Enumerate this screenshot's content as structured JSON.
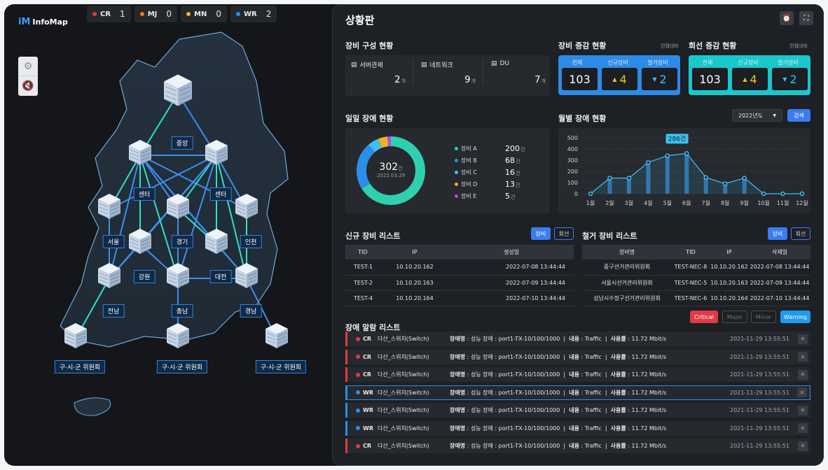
{
  "app": {
    "logo_text": "InfoMap",
    "logo_mark": "iM"
  },
  "counters": [
    {
      "code": "CR",
      "value": "1",
      "color": "#e03a45"
    },
    {
      "code": "MJ",
      "value": "0",
      "color": "#f07a1f"
    },
    {
      "code": "MN",
      "value": "0",
      "color": "#f0b21f"
    },
    {
      "code": "WR",
      "value": "2",
      "color": "#2b8fe6"
    }
  ],
  "side_buttons": {
    "settings_icon": "⚙",
    "mute_icon": "🔇"
  },
  "map": {
    "nodes": [
      "중앙",
      "센터",
      "센터",
      "서울",
      "경기",
      "인천",
      "강원",
      "대전",
      "전남",
      "충남",
      "경남",
      "구·시·군 위원회",
      "구·시·군 위원회",
      "구·시·군 위원회"
    ]
  },
  "panel": {
    "title": "상황판",
    "alarm_icon": "⏰",
    "fullscreen_icon": "⛶",
    "config": {
      "title": "장비 구성 현황",
      "unit": "개",
      "items": [
        {
          "name": "서버관제",
          "count": "2"
        },
        {
          "name": "네트워크",
          "count": "9"
        },
        {
          "name": "DU",
          "count": "7"
        }
      ]
    },
    "equip_change": {
      "title": "장비 증감 현황",
      "sub": "전월대비",
      "headers": [
        "전체",
        "신규장비",
        "철거장비"
      ],
      "total": "103",
      "new": "4",
      "removed": "2"
    },
    "line_change": {
      "title": "회선 증감 현황",
      "sub": "전월대비",
      "headers": [
        "전체",
        "신규장비",
        "철거장비"
      ],
      "total": "103",
      "new": "4",
      "removed": "2"
    },
    "daily": {
      "title": "일일 장애 현황",
      "center_value": "302",
      "center_unit": "건",
      "center_date": "2022.03.29",
      "unit": "건",
      "items": [
        {
          "name": "장비 A",
          "value": 200,
          "color": "#2fd0b0"
        },
        {
          "name": "장비 B",
          "value": 68,
          "color": "#2b8fe6"
        },
        {
          "name": "장비 C",
          "value": 16,
          "color": "#3ec1f0"
        },
        {
          "name": "장비 D",
          "value": 13,
          "color": "#f0b21f"
        },
        {
          "name": "장비 E",
          "value": 5,
          "color": "#b04fe0"
        }
      ]
    },
    "monthly": {
      "title": "월별 장애 현황",
      "year_select": "2022년도",
      "search_label": "검색",
      "highlight_label": "286건"
    },
    "new_list": {
      "title": "신규 장비 리스트",
      "tab_equip": "장비",
      "tab_line": "회선",
      "headers": [
        "TID",
        "IP",
        "생성일"
      ],
      "rows": [
        [
          "TEST-1",
          "10.10.20.162",
          "2022-07-08 13:44:44"
        ],
        [
          "TEST-2",
          "10.10.20.163",
          "2022-07-09 13:44:44"
        ],
        [
          "TEST-4",
          "10.10.20.164",
          "2022-07-10 13:44:44"
        ]
      ]
    },
    "removed_list": {
      "title": "철거 장비 리스트",
      "tab_equip": "장비",
      "tab_line": "회선",
      "headers": [
        "장비명",
        "TID",
        "IP",
        "삭제일"
      ],
      "rows": [
        [
          "중구선거관리위원회",
          "TEST-NEC-8",
          "10.10.20.162",
          "2022-07-08 13:44:44"
        ],
        [
          "서울시선거관리위원회",
          "TEST-NEC-5",
          "10.10.20.163",
          "2022-07-09 13:44:44"
        ],
        [
          "성남시수정구선거관리위원회",
          "TEST-NEC-6",
          "10.10.20.164",
          "2022-07-10 13:44:44"
        ]
      ]
    },
    "alarms": {
      "title": "장애 알람 리스트",
      "filters": [
        "Critical",
        "Major",
        "Minor",
        "Warning"
      ],
      "close_icon": "✕",
      "rows": [
        {
          "level": "CR",
          "device": "다산_스위치(Switch)",
          "k1": "장애명",
          "v1": " : 성능 장애 : port1-TX-10/100/1000",
          "k2": "내용",
          "v2": " : Traffic",
          "k3": "사용률",
          "v3": " : 11.72 Mbit/s",
          "time": "2021-11-29  13:55:51"
        },
        {
          "level": "CR",
          "device": "다산_스위치(Switch)",
          "k1": "장애명",
          "v1": " : 성능 장애 : port1-TX-10/100/1000",
          "k2": "내용",
          "v2": " : Traffic",
          "k3": "사용률",
          "v3": " : 11.72 Mbit/s",
          "time": "2021-11-29  13:55:51"
        },
        {
          "level": "CR",
          "device": "다산_스위치(Switch)",
          "k1": "장애명",
          "v1": " : 성능 장애 : port1-TX-10/100/1000",
          "k2": "내용",
          "v2": " : Traffic",
          "k3": "사용률",
          "v3": " : 11.72 Mbit/s",
          "time": "2021-11-29  13:55:51"
        },
        {
          "level": "WR",
          "device": "다산_스위치(Switch)",
          "k1": "장애명",
          "v1": " : 성능 장애 : port1-TX-10/100/1000",
          "k2": "내용",
          "v2": " : Traffic",
          "k3": "사용률",
          "v3": " : 11.72 Mbit/s",
          "time": "2021-11-29  13:55:51"
        },
        {
          "level": "WR",
          "device": "다산_스위치(Switch)",
          "k1": "장애명",
          "v1": " : 성능 장애 : port1-TX-10/100/1000",
          "k2": "내용",
          "v2": " : Traffic",
          "k3": "사용률",
          "v3": " : 11.72 Mbit/s",
          "time": "2021-11-29  13:55:51"
        },
        {
          "level": "WR",
          "device": "다산_스위치(Switch)",
          "k1": "장애명",
          "v1": " : 성능 장애 : port1-TX-10/100/1000",
          "k2": "내용",
          "v2": " : Traffic",
          "k3": "사용률",
          "v3": " : 11.72 Mbit/s",
          "time": "2021-11-29  13:55:51"
        },
        {
          "level": "CR",
          "device": "다산_스위치(Switch)",
          "k1": "장애명",
          "v1": " : 성능 장애 : port1-TX-10/100/1000",
          "k2": "내용",
          "v2": " : Traffic",
          "k3": "사용률",
          "v3": " : 11.72 Mbit/s",
          "time": "2021-11-29  13:55:51"
        }
      ]
    }
  },
  "chart_data": {
    "type": "bar",
    "categories": [
      "1월",
      "2월",
      "3월",
      "4월",
      "5월",
      "6월",
      "7월",
      "8월",
      "9월",
      "10월",
      "11월",
      "12월"
    ],
    "series": [
      {
        "values": [
          0,
          140,
          140,
          280,
          340,
          360,
          145,
          90,
          140,
          0,
          0,
          0
        ]
      }
    ],
    "yticks": [
      0,
      100,
      200,
      300,
      400,
      500
    ],
    "ylim": [
      0,
      500
    ],
    "highlight": {
      "category": "6월",
      "label": "286건"
    }
  }
}
